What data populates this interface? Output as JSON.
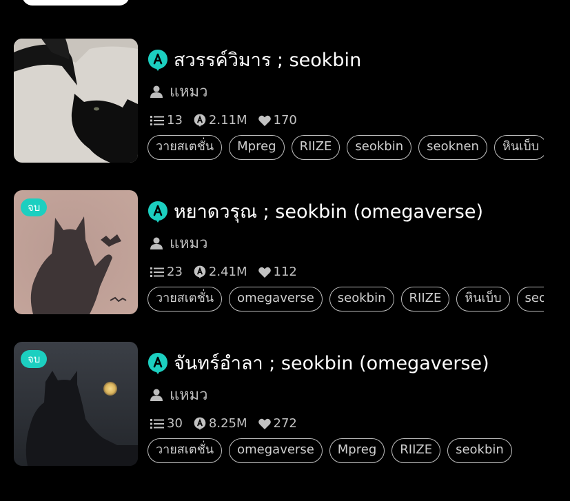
{
  "stories": [
    {
      "title": "สวรรค์วิมาร ; seokbin",
      "author": "แหมว",
      "chapters": "13",
      "reads": "2.11M",
      "likes": "170",
      "status": "",
      "tags": [
        "วายสเตชั่น",
        "Mpreg",
        "RIIZE",
        "seokbin",
        "seoknen",
        "หินเบ็บ"
      ]
    },
    {
      "title": "หยาดวรุณ ; seokbin (omegaverse)",
      "author": "แหมว",
      "chapters": "23",
      "reads": "2.41M",
      "likes": "112",
      "status": "จบ",
      "tags": [
        "วายสเตชั่น",
        "omegaverse",
        "seokbin",
        "RIIZE",
        "หินเบ็บ",
        "seoknen"
      ]
    },
    {
      "title": "จันทร์อำลา ; seokbin (omegaverse)",
      "author": "แหมว",
      "chapters": "30",
      "reads": "8.25M",
      "likes": "272",
      "status": "จบ",
      "tags": [
        "วายสเตชั่น",
        "omegaverse",
        "Mpreg",
        "RIIZE",
        "seokbin"
      ]
    }
  ],
  "colors": {
    "accent": "#1ccfc0",
    "background": "#000000",
    "muted": "#c2c2c2"
  },
  "icons": {
    "app": "app-logo-icon",
    "author": "person-icon",
    "chapters": "list-icon",
    "reads": "reads-icon",
    "likes": "heart-icon"
  }
}
